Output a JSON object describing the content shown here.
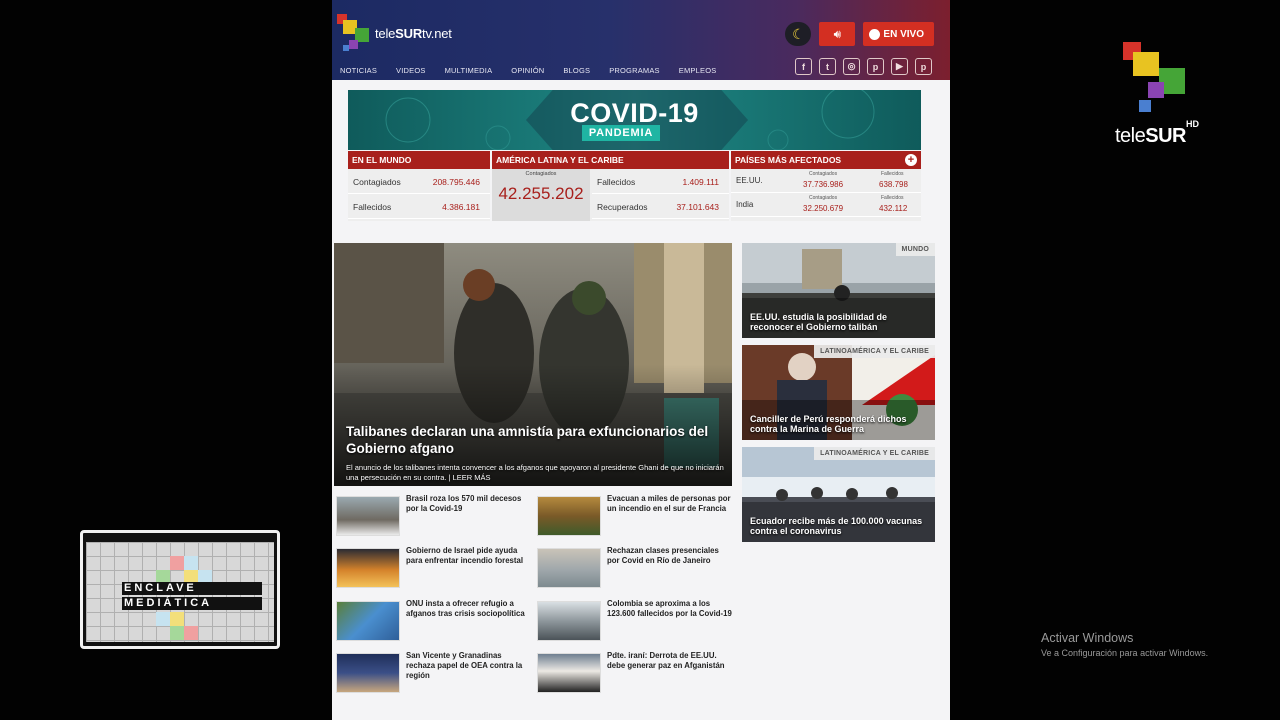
{
  "site": {
    "brand_prefix": "tele",
    "brand_bold": "SUR",
    "brand_suffix": "tv.net",
    "live_label": "EN VIVO",
    "nav": [
      "NOTICIAS",
      "VIDEOS",
      "MULTIMEDIA",
      "OPINIÓN",
      "BLOGS",
      "PROGRAMAS",
      "EMPLEOS"
    ],
    "social": [
      {
        "icon": "facebook-icon",
        "glyph": "f"
      },
      {
        "icon": "twitter-icon",
        "glyph": "t"
      },
      {
        "icon": "instagram-icon",
        "glyph": "◎"
      },
      {
        "icon": "pinterest-icon",
        "glyph": "p"
      },
      {
        "icon": "youtube-icon",
        "glyph": "▶"
      },
      {
        "icon": "patreon-icon",
        "glyph": "p"
      }
    ]
  },
  "covid": {
    "title": "COVID-19",
    "subtitle": "PANDEMIA",
    "world": {
      "header": "EN EL MUNDO",
      "rows": [
        {
          "label": "Contagiados",
          "value": "208.795.446"
        },
        {
          "label": "Fallecidos",
          "value": "4.386.181"
        }
      ]
    },
    "latam": {
      "header": "AMÉRICA LATINA Y EL CARIBE",
      "big_caption": "Contagiados",
      "big_value": "42.255.202",
      "rows": [
        {
          "label": "Fallecidos",
          "value": "1.409.111"
        },
        {
          "label": "Recuperados",
          "value": "37.101.643"
        }
      ]
    },
    "countries": {
      "header": "PAÍSES MÁS AFECTADOS",
      "col1_caption": "Contagiados",
      "col2_caption": "Fallecidos",
      "rows": [
        {
          "country": "EE.UU.",
          "cases": "37.736.986",
          "deaths": "638.798"
        },
        {
          "country": "India",
          "cases": "32.250.679",
          "deaths": "432.112"
        }
      ]
    }
  },
  "hero": {
    "title": "Talibanes declaran una amnistía para exfuncionarios del Gobierno afgano",
    "description": "El anuncio de los talibanes intenta convencer a los afganos que apoyaron al presidente Ghani de que no iniciarán una persecución en su contra. | LEER MÁS"
  },
  "side_cards": [
    {
      "tag": "MUNDO",
      "title": "EE.UU. estudia la posibilidad de reconocer el Gobierno talibán"
    },
    {
      "tag": "LATINOAMÉRICA Y EL CARIBE",
      "title": "Canciller de Perú responderá dichos contra la Marina de Guerra"
    },
    {
      "tag": "LATINOAMÉRICA Y EL CARIBE",
      "title": "Ecuador recibe más de 100.000 vacunas contra el coronavirus"
    }
  ],
  "news": [
    "Brasil roza los 570 mil decesos por la Covid-19",
    "Evacuan a miles de personas por un incendio en el sur de Francia",
    "Gobierno de Israel pide ayuda para enfrentar incendio forestal",
    "Rechazan clases presenciales por Covid en Río de Janeiro",
    "ONU insta a ofrecer refugio a afganos tras crisis sociopolítica",
    "Colombia se aproxima a los 123.600 fallecidos por la Covid-19",
    "San Vicente y Granadinas rechaza papel de OEA contra la región",
    "Pdte. iraní: Derrota de EE.UU. debe generar paz en Afganistán"
  ],
  "tv": {
    "logo_prefix": "tele",
    "logo_bold": "SUR",
    "hd": "HD"
  },
  "enclave": {
    "line1": "ENCLAVE",
    "line2": "MEDIÁTICA"
  },
  "windows": {
    "line1": "Activar Windows",
    "line2": "Ve a Configuración para activar Windows."
  }
}
